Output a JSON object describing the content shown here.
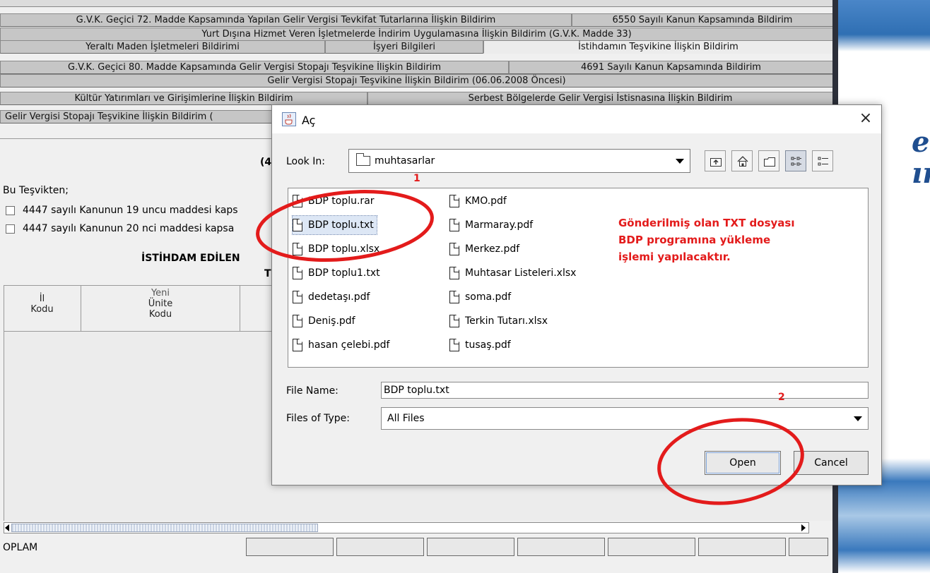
{
  "background_app": {
    "tabs_row1": [
      "G.V.K. Geçici 72. Madde Kapsamında Yapılan Gelir Vergisi Tevkifat Tutarlarına İlişkin Bildirim",
      "6550 Sayılı Kanun Kapsamında Bildirim"
    ],
    "tabs_row2": [
      "Yurt Dışına Hizmet Veren İşletmelerde İndirim Uygulamasına İlişkin Bildirim (G.V.K. Madde 33)"
    ],
    "tabs_row3": [
      "Yeraltı Maden İşletmeleri Bildirimi",
      "İşyeri Bilgileri",
      "İstihdamın Teşvikine İlişkin Bildirim"
    ],
    "tabs_row4": [
      "G.V.K. Geçici 80. Madde Kapsamında Gelir Vergisi Stopajı Teşvikine İlişkin Bildirim",
      "4691 Sayılı Kanun Kapsamında Bildirim"
    ],
    "tabs_row5": [
      "Gelir Vergisi Stopajı Teşvikine İlişkin Bildirim (06.06.2008 Öncesi)"
    ],
    "tabs_row6": [
      "Kültür Yatırımları ve Girişimlerine İlişkin Bildirim",
      "Serbest Bölgelerde Gelir Vergisi İstisnasına İlişkin Bildirim"
    ],
    "tabs_row7": [
      "Gelir Vergisi Stopajı Teşvikine İlişkin Bildirim ("
    ],
    "paren_fragment": "(4",
    "intro": "Bu Teşvikten;",
    "option1": "4447 sayılı Kanunun 19 uncu maddesi kaps",
    "option2": "4447 sayılı Kanunun 20 nci maddesi kapsa",
    "employed_header": "İSTİHDAM EDİLEN",
    "employed_header2": "T",
    "col_il": "İl",
    "col_il2": "Kodu",
    "col_yeni": "Yeni",
    "col_unite": "Ünite",
    "col_kodu": "Kodu",
    "total_label": "OPLAM",
    "banner_letters": "e\nını"
  },
  "dialog": {
    "title": "Aç",
    "look_in_label": "Look In:",
    "look_in_value": "muhtasarlar",
    "files": [
      {
        "name": "BDP toplu.rar",
        "col": 0,
        "row": 0
      },
      {
        "name": "BDP toplu.txt",
        "col": 0,
        "row": 1,
        "selected": true
      },
      {
        "name": "BDP toplu.xlsx",
        "col": 0,
        "row": 2
      },
      {
        "name": "BDP toplu1.txt",
        "col": 0,
        "row": 3
      },
      {
        "name": "dedetaşı.pdf",
        "col": 0,
        "row": 4
      },
      {
        "name": "Deniş.pdf",
        "col": 0,
        "row": 5
      },
      {
        "name": "hasan çelebi.pdf",
        "col": 0,
        "row": 6
      },
      {
        "name": "KMO.pdf",
        "col": 1,
        "row": 0
      },
      {
        "name": "Marmaray.pdf",
        "col": 1,
        "row": 1
      },
      {
        "name": "Merkez.pdf",
        "col": 1,
        "row": 2
      },
      {
        "name": "Muhtasar Listeleri.xlsx",
        "col": 1,
        "row": 3
      },
      {
        "name": "soma.pdf",
        "col": 1,
        "row": 4
      },
      {
        "name": "Terkin Tutarı.xlsx",
        "col": 1,
        "row": 5
      },
      {
        "name": "tusaş.pdf",
        "col": 1,
        "row": 6
      }
    ],
    "file_name_label": "File Name:",
    "file_name_value": "BDP toplu.txt",
    "files_of_type_label": "Files of Type:",
    "files_of_type_value": "All Files",
    "open_label": "Open",
    "cancel_label": "Cancel",
    "close_glyph": "×"
  },
  "annotation": {
    "note": "Gönderilmiş olan TXT dosyası BDP programına yükleme işlemi yapılacaktır.",
    "step1": "1",
    "step2": "2",
    "color": "#e31b1b"
  }
}
